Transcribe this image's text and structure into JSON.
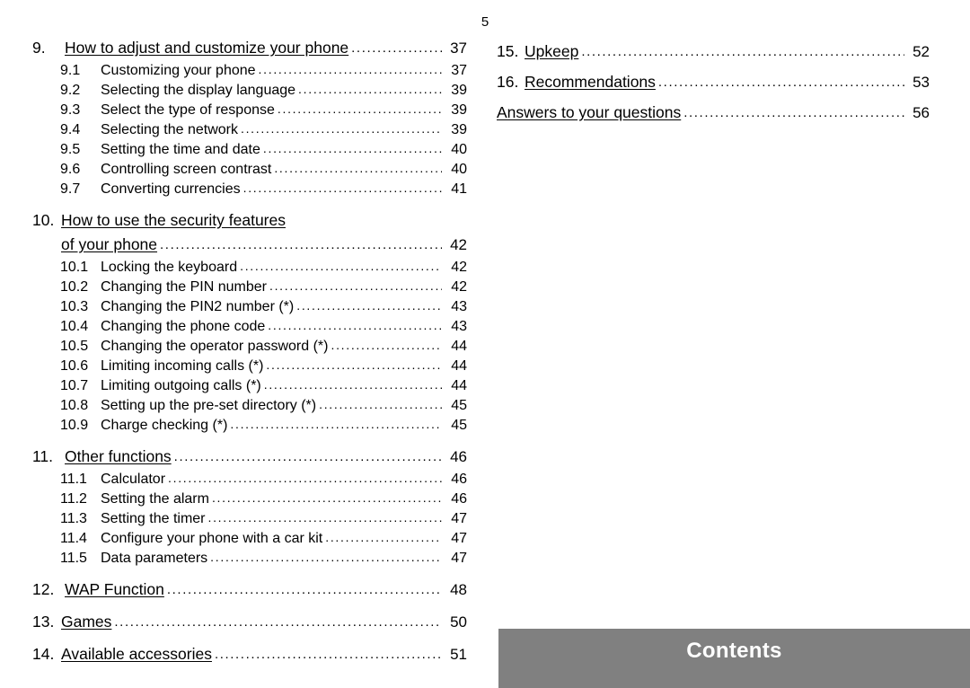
{
  "page": {
    "page_number": "5",
    "footer_label": "Contents",
    "footer_bar_color": "#808080",
    "footer_text_color": "#ffffff",
    "background_color": "#ffffff",
    "text_color": "#000000",
    "dot_leader": "..........................................................................................."
  },
  "left_column": [
    {
      "type": "chapter",
      "number": "9.",
      "title": "How to adjust and customize your phone",
      "page": "37",
      "spacing": "wide"
    },
    {
      "type": "section",
      "number": "9.1",
      "title": "Customizing your phone",
      "page": "37"
    },
    {
      "type": "section",
      "number": "9.2",
      "title": "Selecting the display language",
      "page": "39"
    },
    {
      "type": "section",
      "number": "9.3",
      "title": "Select the type of response",
      "page": "39"
    },
    {
      "type": "section",
      "number": "9.4",
      "title": "Selecting the network",
      "page": "39"
    },
    {
      "type": "section",
      "number": "9.5",
      "title": "Setting the time and date",
      "page": "40"
    },
    {
      "type": "section",
      "number": "9.6",
      "title": "Controlling screen contrast",
      "page": "40"
    },
    {
      "type": "section",
      "number": "9.7",
      "title": "Converting currencies",
      "page": "41"
    },
    {
      "type": "chapter_wrapped",
      "number": "10.",
      "title_line1": "How to use the security features",
      "title_line2": "of your phone",
      "page": "42",
      "spacing": "tight"
    },
    {
      "type": "section",
      "number": "10.1",
      "title": "Locking the keyboard",
      "page": "42"
    },
    {
      "type": "section",
      "number": "10.2",
      "title": "Changing the PIN number",
      "page": "42"
    },
    {
      "type": "section",
      "number": "10.3",
      "title": "Changing the PIN2 number (*)",
      "page": "43"
    },
    {
      "type": "section",
      "number": "10.4",
      "title": "Changing the phone code",
      "page": "43"
    },
    {
      "type": "section",
      "number": "10.5",
      "title": "Changing the operator password (*)",
      "page": "44"
    },
    {
      "type": "section",
      "number": "10.6",
      "title": "Limiting incoming calls (*)",
      "page": "44"
    },
    {
      "type": "section",
      "number": "10.7",
      "title": "Limiting outgoing calls (*)",
      "page": "44"
    },
    {
      "type": "section",
      "number": "10.8",
      "title": "Setting up the pre-set directory (*)",
      "page": "45"
    },
    {
      "type": "section",
      "number": "10.9",
      "title": "Charge checking (*)",
      "page": "45"
    },
    {
      "type": "chapter",
      "number": "11.",
      "title": "Other functions",
      "page": "46",
      "spacing": "wide"
    },
    {
      "type": "section",
      "number": "11.1",
      "title": "Calculator",
      "page": "46"
    },
    {
      "type": "section",
      "number": "11.2",
      "title": "Setting the alarm",
      "page": "46"
    },
    {
      "type": "section",
      "number": "11.3",
      "title": "Setting the timer",
      "page": "47"
    },
    {
      "type": "section",
      "number": "11.4",
      "title": "Configure your phone with a car kit",
      "page": "47"
    },
    {
      "type": "section",
      "number": "11.5",
      "title": "Data parameters",
      "page": "47"
    },
    {
      "type": "chapter",
      "number": "12.",
      "title": "WAP Function",
      "page": "48",
      "spacing": "wide"
    },
    {
      "type": "chapter",
      "number": "13.",
      "title": "Games",
      "page": "50",
      "spacing": "tight"
    },
    {
      "type": "chapter",
      "number": "14.",
      "title": "Available accessories",
      "page": "51",
      "spacing": "tight"
    }
  ],
  "right_column": [
    {
      "type": "chapter",
      "number": "15.",
      "title": "Upkeep",
      "page": "52"
    },
    {
      "type": "chapter",
      "number": "16.",
      "title": "Recommendations",
      "page": "53"
    },
    {
      "type": "chapter",
      "number": "",
      "title": "Answers to your questions",
      "page": "56"
    }
  ]
}
